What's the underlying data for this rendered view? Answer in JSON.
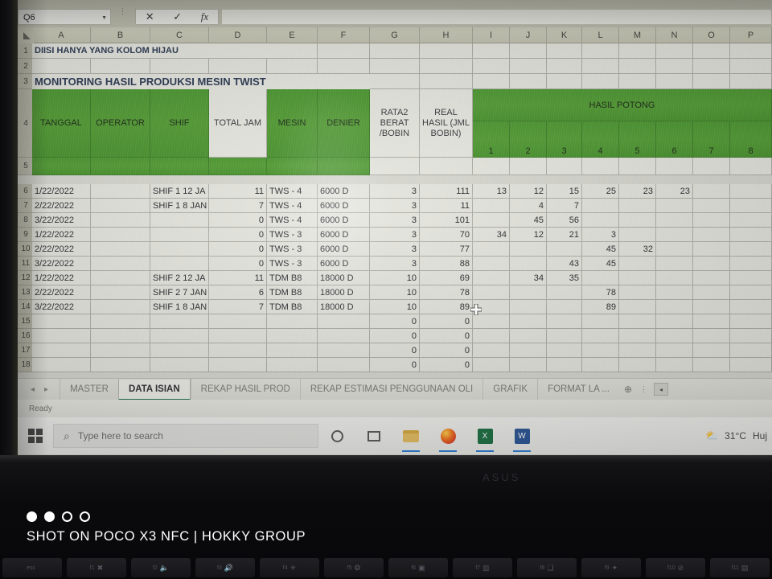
{
  "app": {
    "name_box_value": "Q6",
    "formula_bar_value": "",
    "cancel_icon": "✕",
    "enter_icon": "✓",
    "function_icon": "fx"
  },
  "columns": [
    "A",
    "B",
    "C",
    "D",
    "E",
    "F",
    "G",
    "H",
    "I",
    "J",
    "K",
    "L",
    "M",
    "N",
    "O",
    "P"
  ],
  "row_numbers": [
    "1",
    "2",
    "3",
    "4",
    "5",
    "6",
    "7",
    "8",
    "9",
    "10",
    "11",
    "12",
    "13",
    "14",
    "15",
    "16",
    "17",
    "18"
  ],
  "notes": {
    "row1_text": "DIISI  HANYA YANG KOLOM HIJAU",
    "row3_title": "MONITORING HASIL PRODUKSI MESIN TWIST"
  },
  "table": {
    "headers": {
      "tanggal": "TANGGAL",
      "operator": "OPERATOR",
      "shif": "SHIF",
      "total_jam": "TOTAL JAM",
      "mesin": "MESIN",
      "denier": "DENIER",
      "rata2_berat": "RATA2 BERAT /BOBIN",
      "real_hasil": "REAL HASIL (JML BOBIN)",
      "hasil_potong": "HASIL POTONG",
      "potong_subcolumns": [
        "1",
        "2",
        "3",
        "4",
        "5",
        "6",
        "7",
        "8"
      ]
    },
    "rows": [
      {
        "row": "6",
        "tanggal": "1/22/2022",
        "operator": "",
        "shif": "SHIF 1 12 JA",
        "total_jam": "11",
        "mesin": "TWS - 4",
        "denier": "6000 D",
        "rata2": "3",
        "real": "111",
        "potong": [
          "13",
          "12",
          "15",
          "25",
          "23",
          "23",
          "",
          ""
        ]
      },
      {
        "row": "7",
        "tanggal": "2/22/2022",
        "operator": "",
        "shif": "SHIF 1 8 JAN",
        "total_jam": "7",
        "mesin": "TWS - 4",
        "denier": "6000 D",
        "rata2": "3",
        "real": "11",
        "potong": [
          "",
          "4",
          "7",
          "",
          "",
          "",
          "",
          ""
        ]
      },
      {
        "row": "8",
        "tanggal": "3/22/2022",
        "operator": "",
        "shif": "",
        "total_jam": "0",
        "mesin": "TWS - 4",
        "denier": "6000 D",
        "rata2": "3",
        "real": "101",
        "potong": [
          "",
          "45",
          "56",
          "",
          "",
          "",
          "",
          ""
        ]
      },
      {
        "row": "9",
        "tanggal": "1/22/2022",
        "operator": "",
        "shif": "",
        "total_jam": "0",
        "mesin": "TWS - 3",
        "denier": "6000 D",
        "rata2": "3",
        "real": "70",
        "potong": [
          "34",
          "12",
          "21",
          "3",
          "",
          "",
          "",
          ""
        ]
      },
      {
        "row": "10",
        "tanggal": "2/22/2022",
        "operator": "",
        "shif": "",
        "total_jam": "0",
        "mesin": "TWS - 3",
        "denier": "6000 D",
        "rata2": "3",
        "real": "77",
        "potong": [
          "",
          "",
          "",
          "45",
          "32",
          "",
          "",
          ""
        ]
      },
      {
        "row": "11",
        "tanggal": "3/22/2022",
        "operator": "",
        "shif": "",
        "total_jam": "0",
        "mesin": "TWS - 3",
        "denier": "6000 D",
        "rata2": "3",
        "real": "88",
        "potong": [
          "",
          "",
          "43",
          "45",
          "",
          "",
          "",
          ""
        ]
      },
      {
        "row": "12",
        "tanggal": "1/22/2022",
        "operator": "",
        "shif": "SHIF 2 12 JA",
        "total_jam": "11",
        "mesin": "TDM B8",
        "denier": "18000 D",
        "rata2": "10",
        "real": "69",
        "potong": [
          "",
          "34",
          "35",
          "",
          "",
          "",
          "",
          ""
        ]
      },
      {
        "row": "13",
        "tanggal": "2/22/2022",
        "operator": "",
        "shif": "SHIF 2 7 JAN",
        "total_jam": "6",
        "mesin": "TDM B8",
        "denier": "18000 D",
        "rata2": "10",
        "real": "78",
        "potong": [
          "",
          "",
          "",
          "78",
          "",
          "",
          "",
          ""
        ]
      },
      {
        "row": "14",
        "tanggal": "3/22/2022",
        "operator": "",
        "shif": "SHIF 1 8 JAN",
        "total_jam": "7",
        "mesin": "TDM B8",
        "denier": "18000 D",
        "rata2": "10",
        "real": "89",
        "potong": [
          "",
          "",
          "",
          "89",
          "",
          "",
          "",
          ""
        ]
      },
      {
        "row": "15",
        "tanggal": "",
        "operator": "",
        "shif": "",
        "total_jam": "",
        "mesin": "",
        "denier": "",
        "rata2": "0",
        "real": "0",
        "potong": [
          "",
          "",
          "",
          "",
          "",
          "",
          "",
          ""
        ]
      },
      {
        "row": "16",
        "tanggal": "",
        "operator": "",
        "shif": "",
        "total_jam": "",
        "mesin": "",
        "denier": "",
        "rata2": "0",
        "real": "0",
        "potong": [
          "",
          "",
          "",
          "",
          "",
          "",
          "",
          ""
        ]
      },
      {
        "row": "17",
        "tanggal": "",
        "operator": "",
        "shif": "",
        "total_jam": "",
        "mesin": "",
        "denier": "",
        "rata2": "0",
        "real": "0",
        "potong": [
          "",
          "",
          "",
          "",
          "",
          "",
          "",
          ""
        ]
      },
      {
        "row": "18",
        "tanggal": "",
        "operator": "",
        "shif": "",
        "total_jam": "",
        "mesin": "",
        "denier": "",
        "rata2": "0",
        "real": "0",
        "potong": [
          "",
          "",
          "",
          "",
          "",
          "",
          "",
          ""
        ]
      }
    ]
  },
  "sheet_tabs": {
    "prev_label": "◂",
    "next_label": "▸",
    "items": [
      {
        "label": "MASTER",
        "active": false
      },
      {
        "label": "DATA ISIAN",
        "active": true
      },
      {
        "label": "REKAP HASIL PROD",
        "active": false
      },
      {
        "label": "REKAP ESTIMASI PENGGUNAAN OLI",
        "active": false
      },
      {
        "label": "GRAFIK",
        "active": false
      },
      {
        "label": "FORMAT LA ...",
        "active": false
      }
    ],
    "add_sheet_label": "⊕",
    "overflow_label": "⋮",
    "scroll_left_label": "◂"
  },
  "status_bar": {
    "text": "Ready"
  },
  "taskbar": {
    "start_label": "start",
    "search_placeholder": "Type here to search",
    "search_icon": "⌕",
    "cortana_icon": "○",
    "taskview_icon": "❑",
    "apps": [
      {
        "name": "file-explorer",
        "label": "File Explorer"
      },
      {
        "name": "firefox",
        "label": "Firefox"
      },
      {
        "name": "excel",
        "label": "Excel"
      },
      {
        "name": "word",
        "label": "Word"
      }
    ],
    "weather_temp": "31°C",
    "weather_desc": "Huj"
  },
  "device": {
    "brand_logo": "ASUS",
    "watermark_text": "SHOT ON POCO X3 NFC | HOKKY GROUP",
    "watermark_dots": [
      true,
      true,
      false,
      false
    ]
  },
  "keyboard": {
    "keys": [
      {
        "label": "esc",
        "glyph": ""
      },
      {
        "label": "f1",
        "glyph": "✖"
      },
      {
        "label": "f2",
        "glyph": "🔈"
      },
      {
        "label": "f3",
        "glyph": "🔊"
      },
      {
        "label": "f4",
        "glyph": "✳"
      },
      {
        "label": "f5",
        "glyph": "❂"
      },
      {
        "label": "f6",
        "glyph": "▣"
      },
      {
        "label": "f7",
        "glyph": "▥"
      },
      {
        "label": "f8",
        "glyph": "❏"
      },
      {
        "label": "f9",
        "glyph": "✦"
      },
      {
        "label": "f10",
        "glyph": "⊘"
      },
      {
        "label": "f11",
        "glyph": "▤"
      }
    ]
  },
  "colors": {
    "header_green": "#4e9a33",
    "title_blue": "#2c3b55",
    "active_tab_underline": "#1e7145"
  }
}
